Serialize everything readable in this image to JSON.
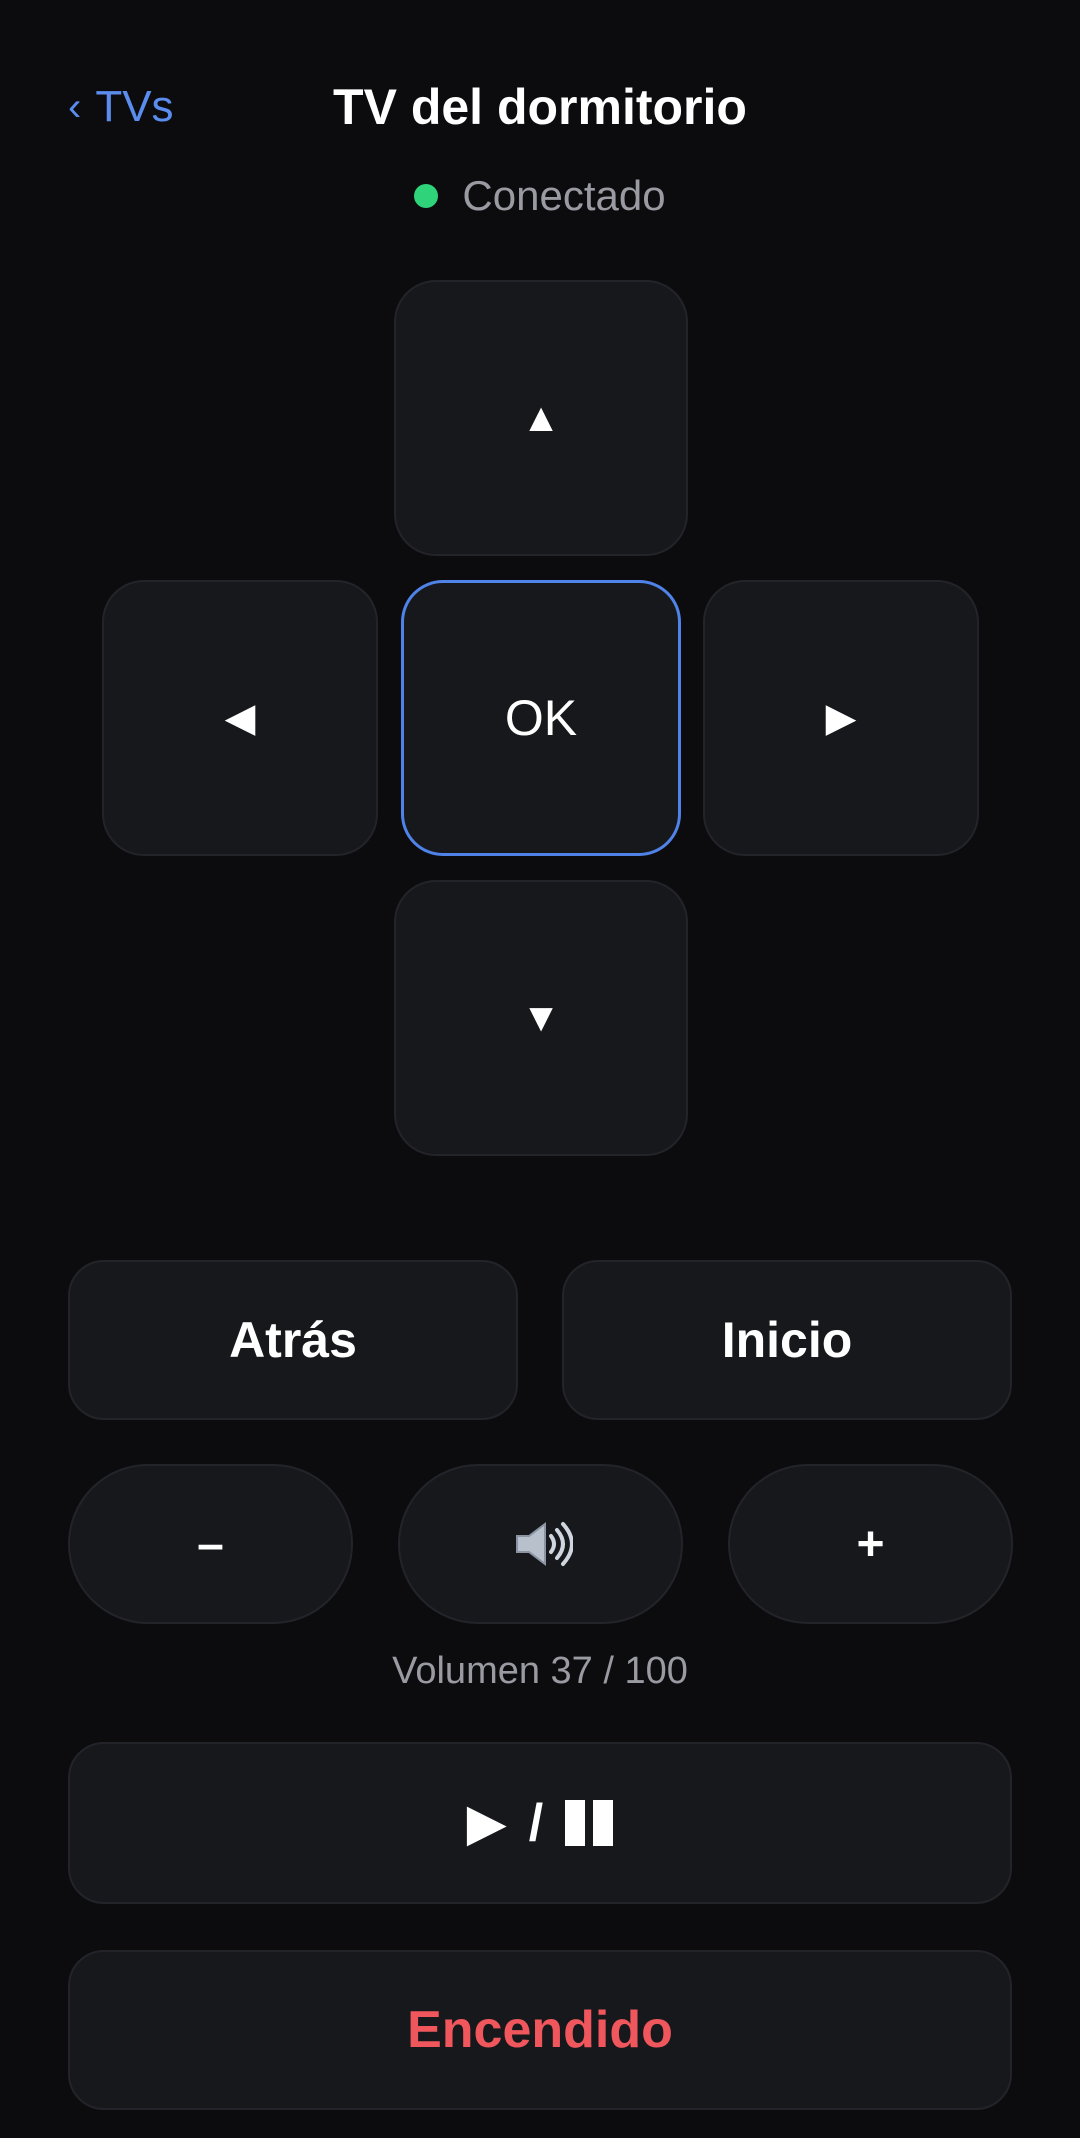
{
  "header": {
    "back_chevron": "‹",
    "back_label": "TVs",
    "title": "TV del dormitorio"
  },
  "status": {
    "text": "Conectado",
    "color": "#2fd37a"
  },
  "dpad": {
    "up": "▲",
    "left": "◀",
    "ok": "OK",
    "right": "▶",
    "down": "▼"
  },
  "nav_buttons": {
    "back": "Atrás",
    "home": "Inicio"
  },
  "volume": {
    "down_label": "–",
    "mute_icon": "speaker-icon",
    "up_label": "+",
    "level": 37,
    "max": 100,
    "label": "Volumen 37 / 100"
  },
  "playback": {
    "play_symbol": "▶",
    "separator": "/",
    "pause_icon": "pause-icon"
  },
  "power": {
    "label": "Encendido",
    "color": "#f0575d"
  },
  "colors": {
    "accent": "#5b8def",
    "ok_border": "#4f83e8",
    "background": "#0c0c0e",
    "button": "#17181c"
  }
}
